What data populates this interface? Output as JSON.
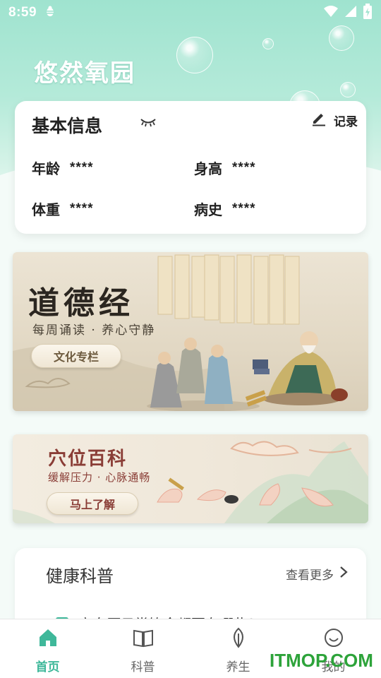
{
  "status_bar": {
    "time": "8:59"
  },
  "app": {
    "logo_text": "悠然氧园"
  },
  "info_card": {
    "title": "基本信息",
    "record_label": "记录",
    "fields": [
      {
        "label": "年龄",
        "value": "****"
      },
      {
        "label": "身高",
        "value": "****"
      },
      {
        "label": "体重",
        "value": "****"
      },
      {
        "label": "病史",
        "value": "****"
      }
    ]
  },
  "banners": [
    {
      "title": "道德经",
      "subtitle": "每周诵读 · 养心守静",
      "button": "文化专栏"
    },
    {
      "title": "穴位百科",
      "subtitle": "缓解压力 · 心脉通畅",
      "button": "马上了解"
    }
  ],
  "health": {
    "title": "健康科普",
    "more_label": "查看更多",
    "first_item": "高血压日常饮食都要有哪些?"
  },
  "tabs": [
    {
      "label": "首页",
      "icon": "home-icon"
    },
    {
      "label": "科普",
      "icon": "book-icon"
    },
    {
      "label": "养生",
      "icon": "leaf-icon"
    },
    {
      "label": "我的",
      "icon": "smile-icon"
    }
  ],
  "watermark": "ITMOP.COM",
  "colors": {
    "accent": "#3fb89a",
    "hero": "#9fe3cf"
  }
}
